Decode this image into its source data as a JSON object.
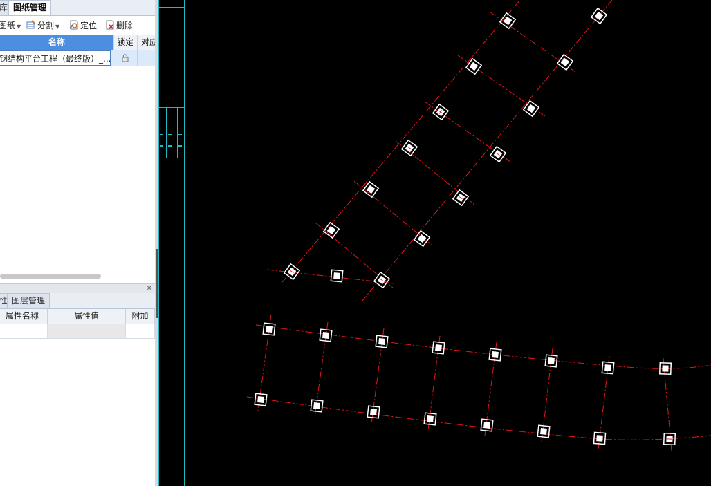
{
  "panel_top": {
    "tabs": [
      {
        "label": "库"
      },
      {
        "label": "图纸管理",
        "active": true
      }
    ],
    "toolbar": {
      "add_drawing": "图纸",
      "split": "分割",
      "locate": "定位",
      "delete": "删除"
    },
    "columns": {
      "name": "名称",
      "lock": "锁定",
      "match": "对应"
    },
    "rows": [
      {
        "name": "钢结构平台工程（最终版）_...",
        "locked": true
      }
    ]
  },
  "panel_bottom": {
    "tabs": [
      {
        "label": "性"
      },
      {
        "label": "图层管理"
      }
    ],
    "columns": {
      "prop_name": "属性名称",
      "prop_value": "属性值",
      "extra": "附加"
    }
  },
  "colors": {
    "canvas_bg": "#000000",
    "axis_line": "#e8161b",
    "column_marker": "#ffffff",
    "frame_line": "#1fb8c4",
    "tab_active_header": "#4c8ee0"
  }
}
